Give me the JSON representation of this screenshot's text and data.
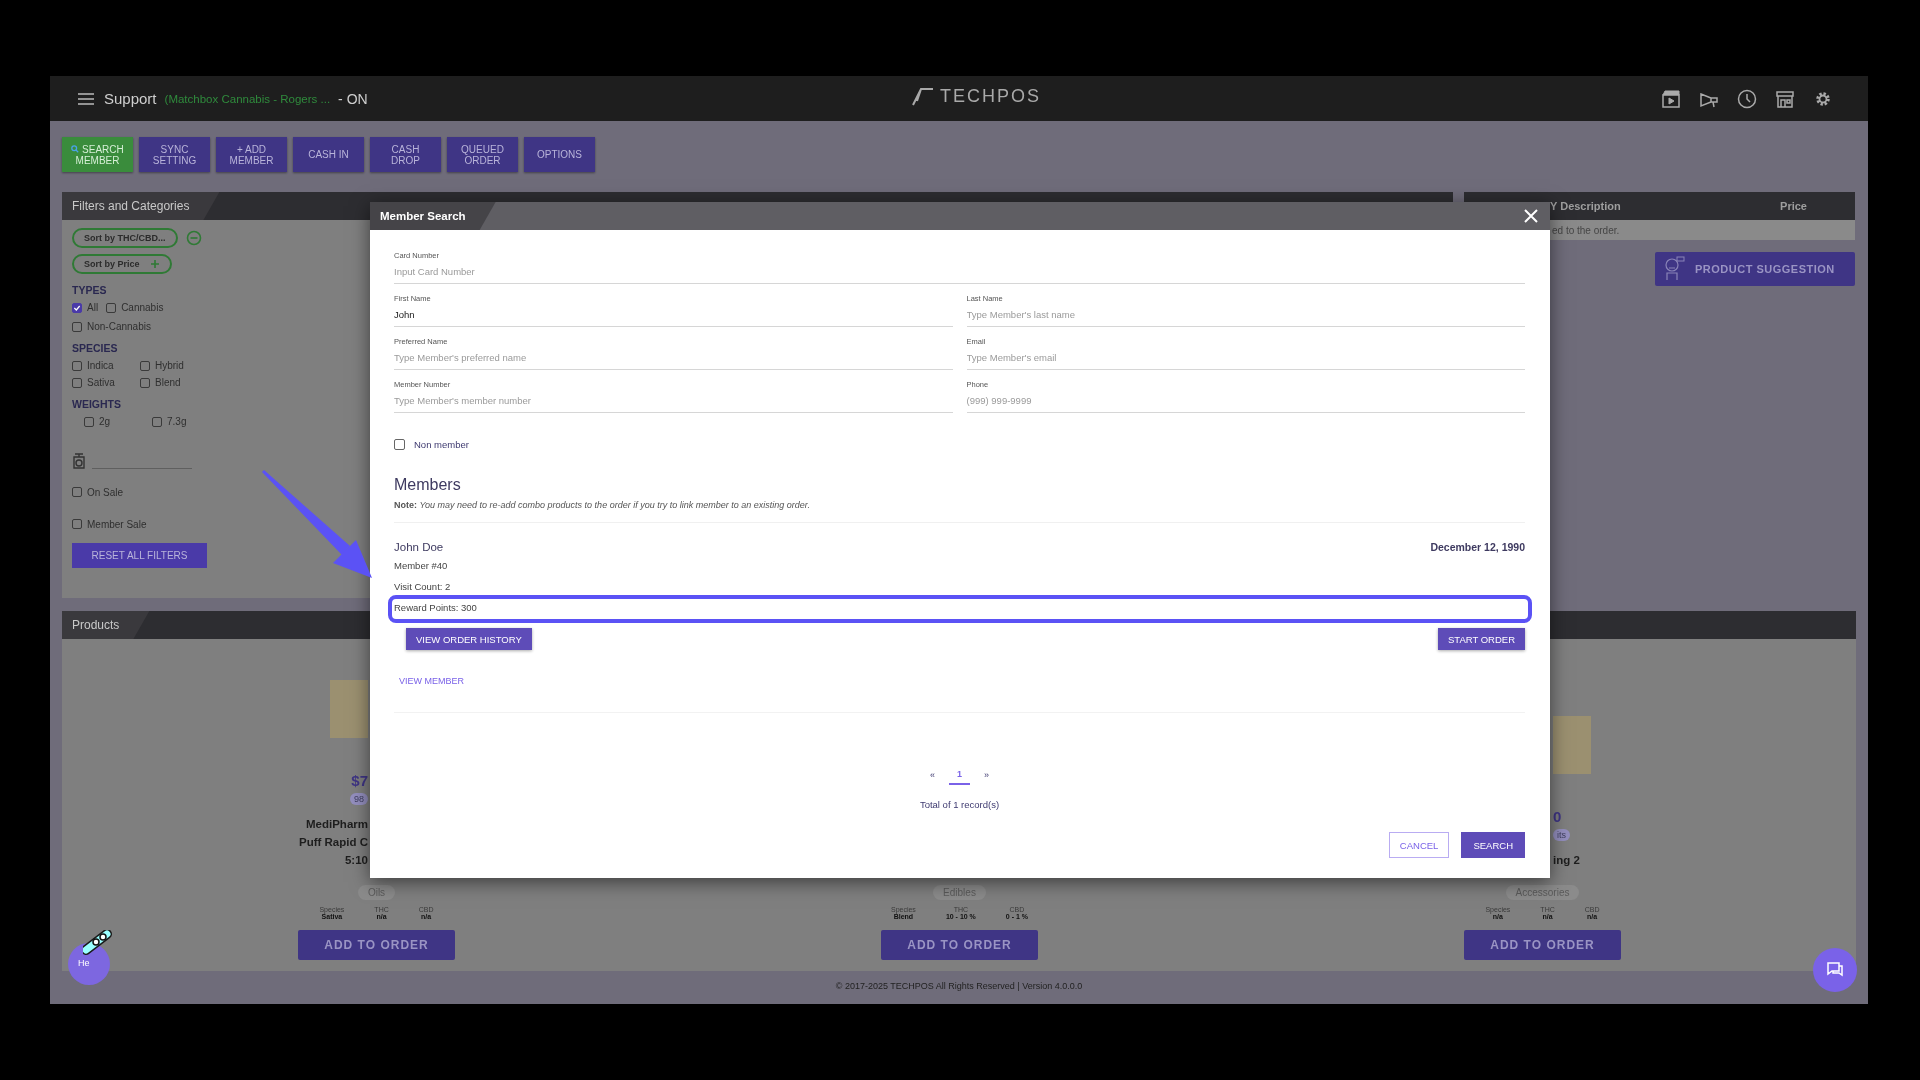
{
  "header": {
    "menu_label": "Support",
    "store": "(Matchbox Cannabis - Rogers ...",
    "status": "- ON",
    "logo": "TECHPOS"
  },
  "toolbar": [
    {
      "label": "SEARCH MEMBER",
      "kind": "search",
      "selected": true
    },
    {
      "label": "SYNC SETTING",
      "kind": "plain",
      "selected": false
    },
    {
      "label": "+ ADD MEMBER",
      "kind": "plain",
      "selected": false
    },
    {
      "label": "CASH IN",
      "kind": "plain",
      "selected": false
    },
    {
      "label": "CASH DROP",
      "kind": "plain",
      "selected": false
    },
    {
      "label": "QUEUED ORDER",
      "kind": "plain",
      "selected": false
    },
    {
      "label": "OPTIONS",
      "kind": "plain",
      "selected": false
    }
  ],
  "filters": {
    "title": "Filters and Categories",
    "sorts": [
      {
        "label": "Sort by THC/CBD...",
        "kind": "remove"
      },
      {
        "label": "Sort by Price",
        "kind": "add"
      }
    ],
    "groups": [
      {
        "title": "TYPES",
        "options": [
          {
            "label": "All",
            "checked": true
          },
          {
            "label": "Cannabis",
            "checked": false
          },
          {
            "label": "Non-Cannabis",
            "checked": false
          }
        ]
      },
      {
        "title": "SPECIES",
        "options": [
          {
            "label": "Indica",
            "checked": false
          },
          {
            "label": "Hybrid",
            "checked": false
          },
          {
            "label": "Sativa",
            "checked": false
          },
          {
            "label": "Blend",
            "checked": false
          }
        ]
      },
      {
        "title": "WEIGHTS",
        "options": [
          {
            "label": "2g",
            "checked": false
          },
          {
            "label": "7.3g",
            "checked": false
          }
        ]
      }
    ],
    "sales": [
      {
        "label": "On Sale",
        "checked": false
      },
      {
        "label": "Member Sale",
        "checked": false
      }
    ],
    "reset": "RESET ALL FILTERS"
  },
  "order_panel": {
    "columns": [
      "Y Description",
      "Price"
    ],
    "empty_text": "ed to the order.",
    "suggestion_button": "PRODUCT SUGGESTION"
  },
  "products": {
    "title": "Products",
    "items": [
      {
        "price": "$7",
        "badge": "98",
        "name": [
          "MediPharm",
          "Puff Rapid C",
          "5:10"
        ],
        "category": "Oils",
        "specs": [
          {
            "label": "Species",
            "value": "Sativa"
          },
          {
            "label": "THC",
            "value": "n/a"
          },
          {
            "label": "CBD",
            "value": "n/a"
          }
        ],
        "button": "ADD TO ORDER"
      },
      {
        "category": "Edibles",
        "specs": [
          {
            "label": "Species",
            "value": "Blend"
          },
          {
            "label": "THC",
            "value": "10 - 10 %"
          },
          {
            "label": "CBD",
            "value": "0 - 1 %"
          }
        ],
        "button": "ADD TO ORDER"
      },
      {
        "price": "0",
        "badge": "its",
        "name": [
          "ing 2"
        ],
        "category": "Accessories",
        "specs": [
          {
            "label": "Species",
            "value": "n/a"
          },
          {
            "label": "THC",
            "value": "n/a"
          },
          {
            "label": "CBD",
            "value": "n/a"
          }
        ],
        "button": "ADD TO ORDER"
      }
    ]
  },
  "footer": "© 2017-2025 TECHPOS All Rights Reserved | Version 4.0.0.0",
  "help_label": "He",
  "modal": {
    "title": "Member Search",
    "field_rows": [
      [
        {
          "label": "Card Number",
          "placeholder": "Input Card Number"
        }
      ],
      [
        {
          "label": "First Name",
          "value": "John"
        },
        {
          "label": "Last Name",
          "placeholder": "Type Member's last name"
        }
      ],
      [
        {
          "label": "Preferred Name",
          "placeholder": "Type Member's preferred name"
        },
        {
          "label": "Email",
          "placeholder": "Type Member's email"
        }
      ],
      [
        {
          "label": "Member Number",
          "placeholder": "Type Member's member number"
        },
        {
          "label": "Phone",
          "placeholder": "(999) 999-9999"
        }
      ]
    ],
    "non_member": {
      "label": "Non member",
      "checked": false
    },
    "members_title": "Members",
    "note": "**Note:** *You may need to re-add combo products to the order if you try to link member to an existing order.*",
    "results": [
      {
        "name": "John Doe",
        "date": "December 12, 1990",
        "lines": [
          {
            "text": "Member #40",
            "highlighted": false
          },
          {
            "text": "Visit Count: 2",
            "highlighted": false
          },
          {
            "text": "Reward Points: 300",
            "highlighted": true
          }
        ],
        "history_button": "VIEW ORDER HISTORY",
        "start_button": "START ORDER",
        "view_link": "VIEW MEMBER"
      }
    ],
    "pagination": {
      "prev": "«",
      "pages": [
        {
          "label": "1",
          "selected": true
        }
      ],
      "next": "»",
      "total": "Total of 1 record(s)"
    },
    "cancel": "CANCEL",
    "search": "SEARCH"
  }
}
